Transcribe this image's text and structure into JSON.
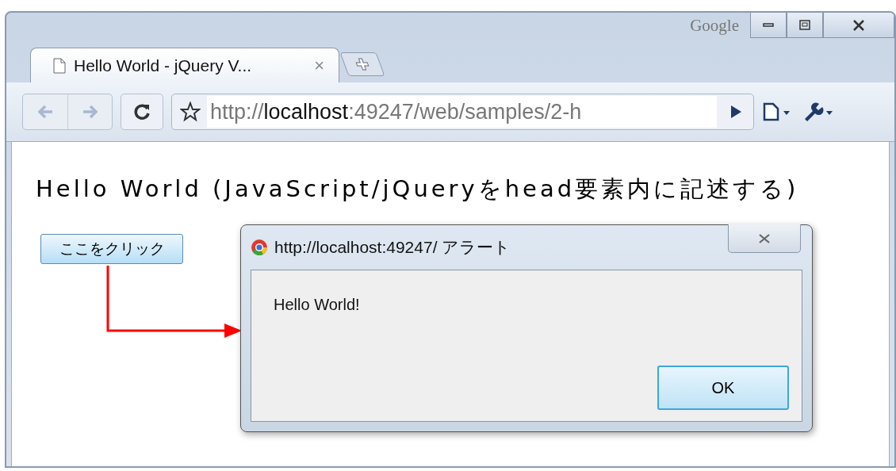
{
  "window": {
    "brand": "Google"
  },
  "tabs": [
    {
      "title": "Hello World - jQuery V...",
      "close": "×",
      "selected": true
    }
  ],
  "toolbar": {
    "url": {
      "scheme": "http://",
      "host": "localhost",
      "rest": ":49247/web/samples/2-h"
    }
  },
  "page": {
    "heading": "Hello World (JavaScript/jQueryをhead要素内に記述する)",
    "button": "ここをクリック"
  },
  "dialog": {
    "title": "http://localhost:49247/ アラート",
    "message": "Hello World!",
    "ok": "OK"
  }
}
